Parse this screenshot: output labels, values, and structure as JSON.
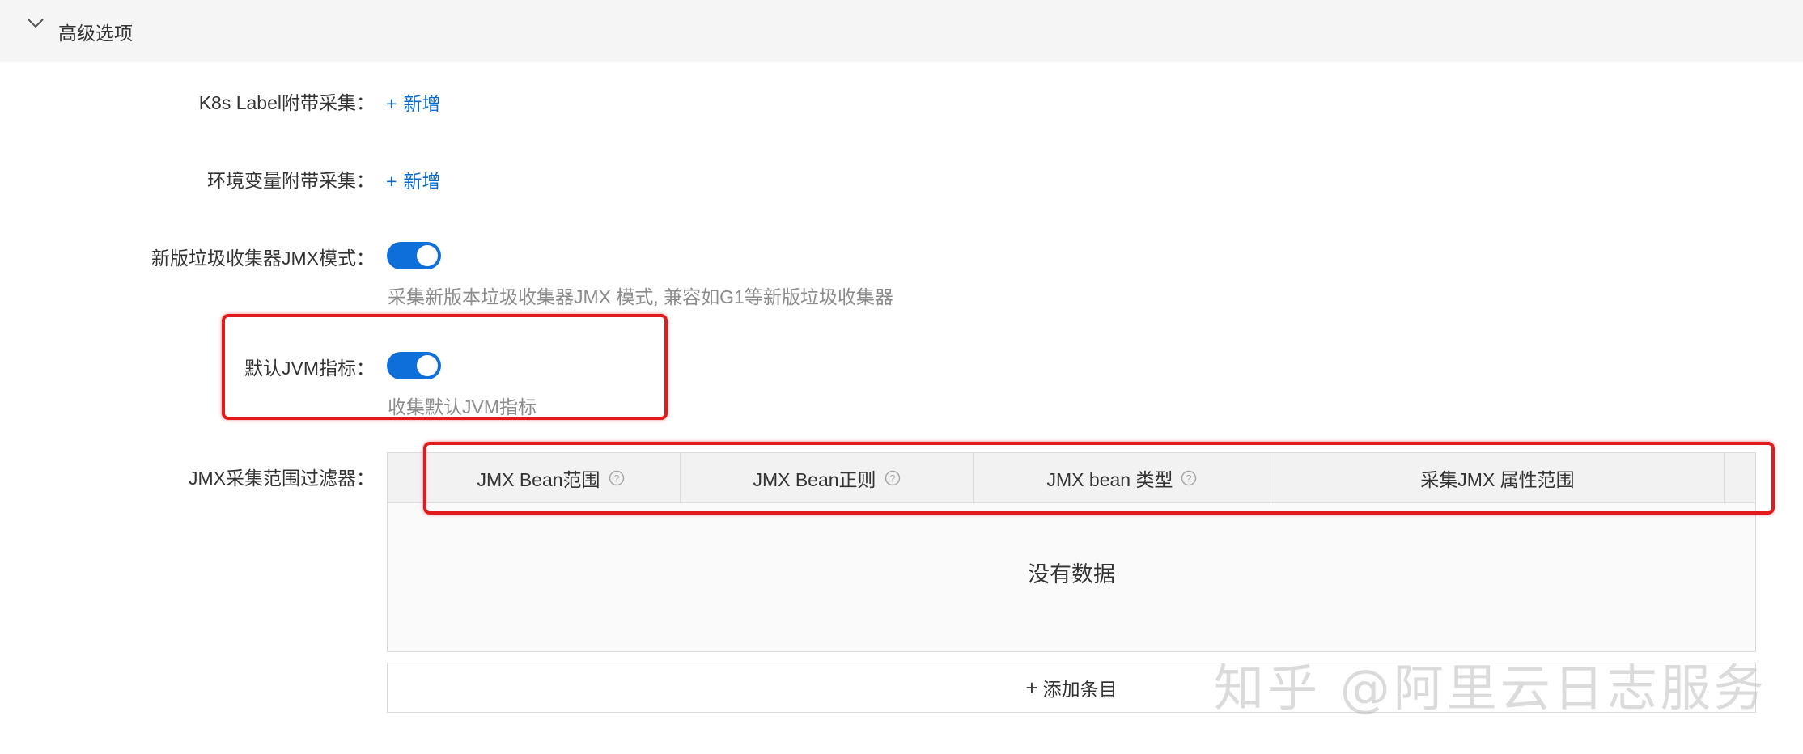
{
  "section": {
    "title": "高级选项",
    "icon": "chevron-down-icon"
  },
  "fields": {
    "k8s_label": {
      "label": "K8s Label附带采集：",
      "add_label": "新增",
      "add_icon": "+"
    },
    "env_var": {
      "label": "环境变量附带采集：",
      "add_label": "新增",
      "add_icon": "+"
    },
    "gc_jmx": {
      "label": "新版垃圾收集器JMX模式：",
      "checked": true,
      "hint": "采集新版本垃圾收集器JMX 模式, 兼容如G1等新版垃圾收集器"
    },
    "default_jvm": {
      "label": "默认JVM指标：",
      "checked": true,
      "hint": "收集默认JVM指标"
    },
    "jmx_filter": {
      "label": "JMX采集范围过滤器：",
      "columns": [
        {
          "title": "JMX Bean范围",
          "help": true
        },
        {
          "title": "JMX Bean正则",
          "help": true
        },
        {
          "title": "JMX bean 类型",
          "help": true
        },
        {
          "title": "采集JMX 属性范围",
          "help": false
        }
      ],
      "empty_text": "没有数据",
      "add_row_icon": "+",
      "add_row_label": "添加条目"
    }
  },
  "watermark": "知乎 @阿里云日志服务",
  "colors": {
    "accent": "#0e6fdb",
    "link": "#0a6ad0",
    "highlight": "#e11b1b"
  }
}
